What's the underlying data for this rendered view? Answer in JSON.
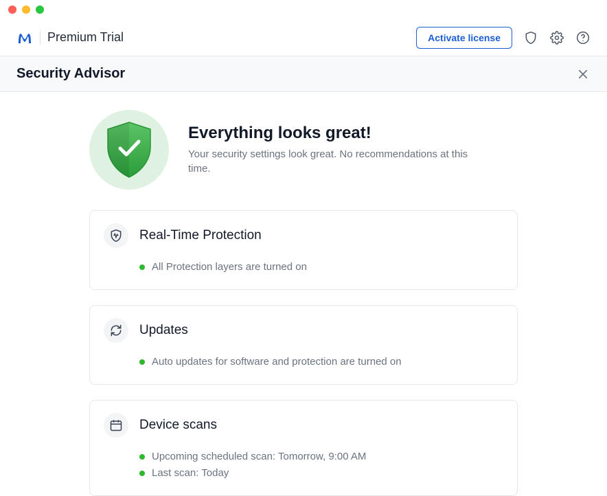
{
  "header": {
    "product_tier": "Premium Trial",
    "activate_button": "Activate license"
  },
  "subheader": {
    "title": "Security Advisor"
  },
  "hero": {
    "title": "Everything looks great!",
    "subtitle": "Your security settings look great. No recommendations at this time."
  },
  "cards": [
    {
      "title": "Real-Time Protection",
      "items": [
        "All Protection layers are turned on"
      ]
    },
    {
      "title": "Updates",
      "items": [
        "Auto updates for software and protection are turned on"
      ]
    },
    {
      "title": "Device scans",
      "items": [
        "Upcoming scheduled scan: Tomorrow, 9:00 AM",
        "Last scan: Today"
      ]
    }
  ],
  "colors": {
    "primary_blue": "#1c5ed6",
    "success_green": "#2eb82e",
    "badge_bg": "#dff1e0"
  }
}
